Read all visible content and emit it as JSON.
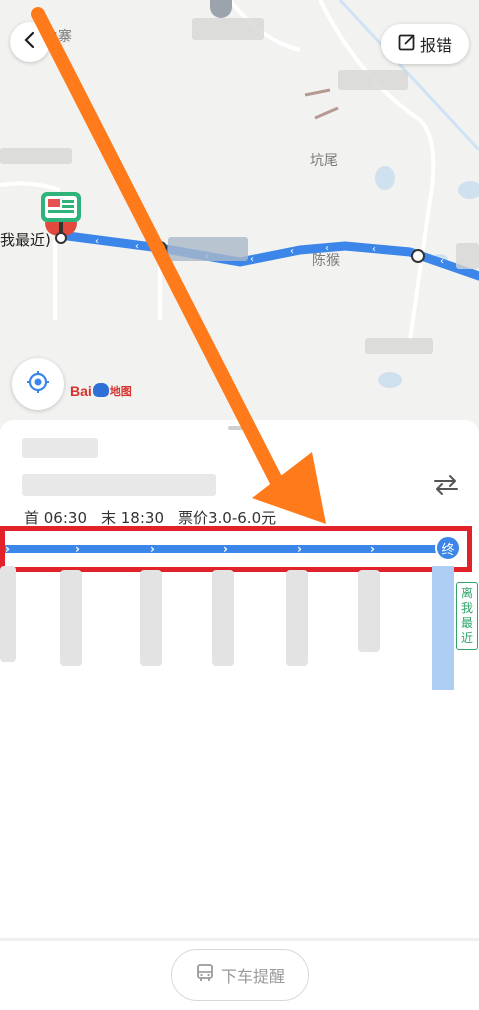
{
  "map": {
    "places": [
      "角寨",
      "坑尾",
      "陈猴"
    ],
    "nearest_stop_label": "我最近)",
    "logo_text_en": "Bai",
    "logo_text_cn": "地图"
  },
  "header": {
    "report_label": "报错"
  },
  "schedule": {
    "first_label": "首 06:30",
    "last_label": "末 18:30",
    "fare_label": "票价3.0-6.0元"
  },
  "route": {
    "end_badge": "终",
    "nearest_tag": "离我最近",
    "line_color": "#3b86e8",
    "highlight_color": "#e1222b"
  },
  "footer": {
    "alight_reminder_label": "下车提醒"
  },
  "icons": [
    "back-icon",
    "edit-icon",
    "locate-icon",
    "swap-icon",
    "bus-icon",
    "poi-icon",
    "bus-stop-pin-icon"
  ],
  "annotation": {
    "arrow_color": "#ff7a1a"
  }
}
